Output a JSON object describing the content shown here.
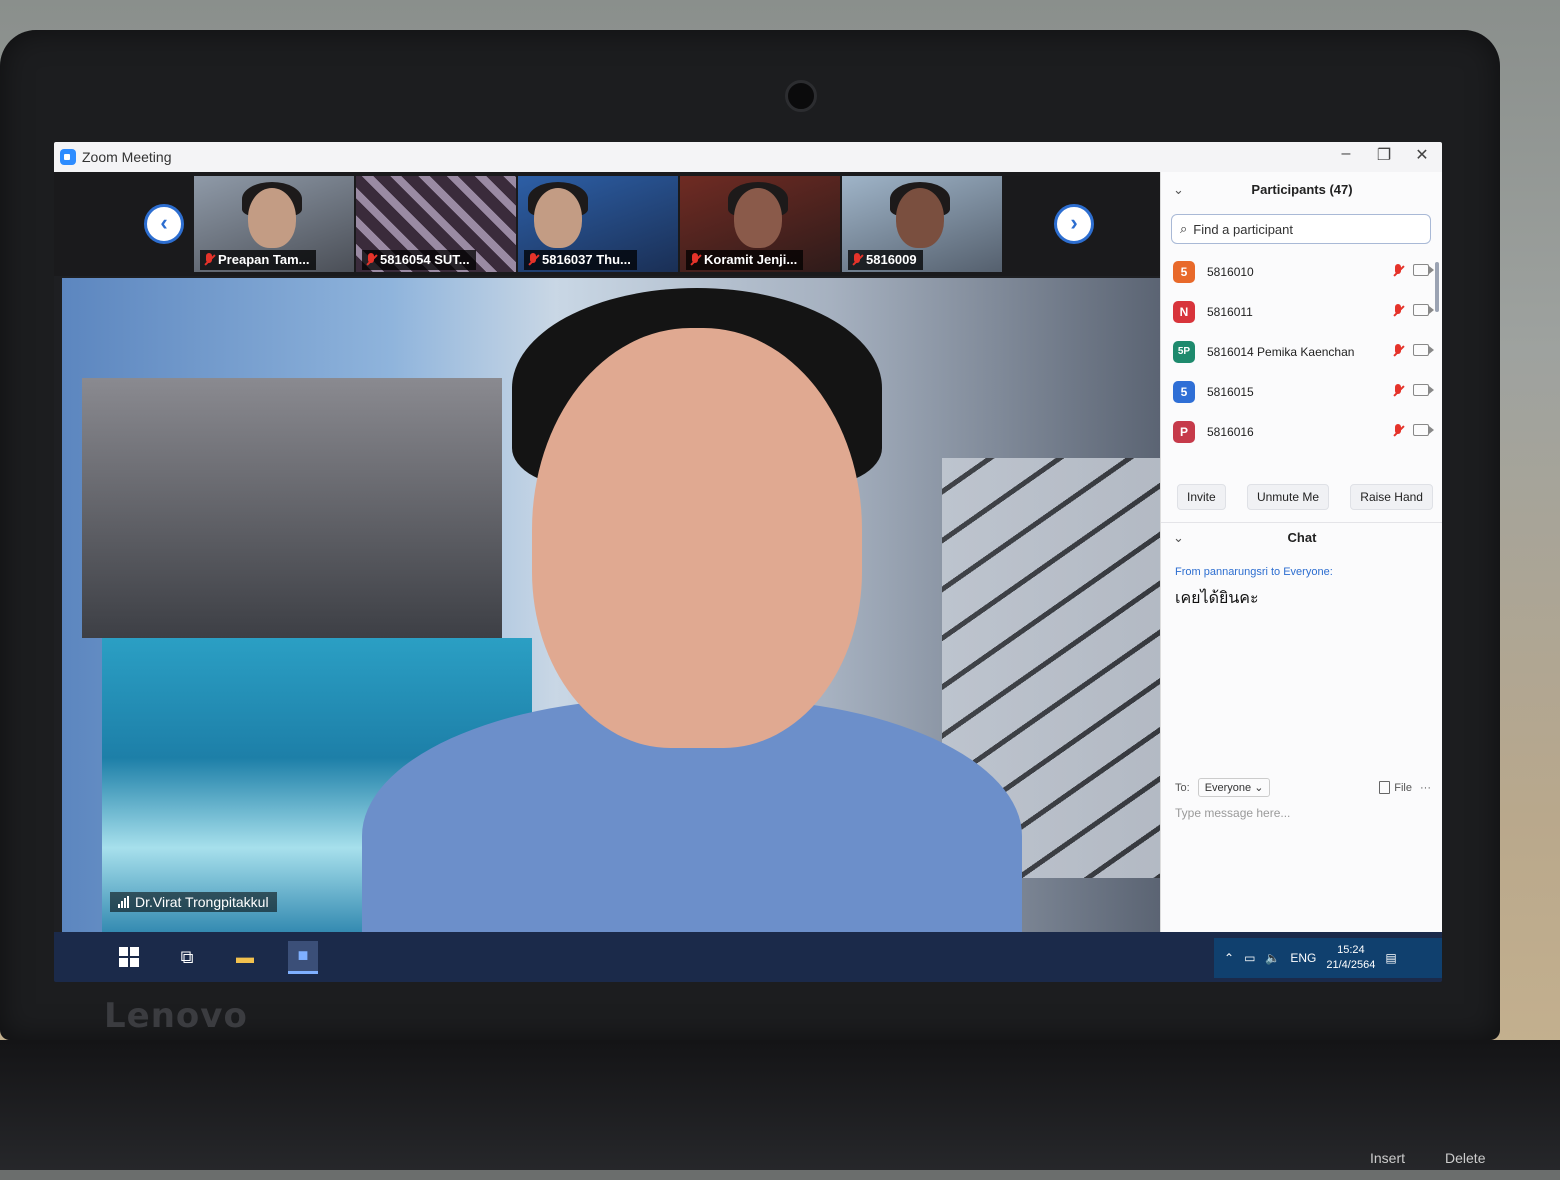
{
  "window": {
    "title": "Zoom Meeting",
    "controls": [
      "–",
      "❐",
      "✕"
    ]
  },
  "thumbnails": [
    {
      "name": "Preapan Tam..."
    },
    {
      "name": "5816054 SUT..."
    },
    {
      "name": "5816037 Thu..."
    },
    {
      "name": "Koramit Jenji..."
    },
    {
      "name": "5816009"
    }
  ],
  "nav": {
    "prev": "‹",
    "next": "›"
  },
  "speaker": {
    "name": "Dr.Virat Trongpitakkul"
  },
  "participants": {
    "header": "Participants (47)",
    "search_placeholder": "Find a participant",
    "items": [
      {
        "initial": "5",
        "name": "5816010",
        "color": "#e8692a"
      },
      {
        "initial": "N",
        "name": "5816011",
        "color": "#d8343b"
      },
      {
        "initial": "5P",
        "name": "5816014 Pemika Kaenchan",
        "color": "#1e8a6d"
      },
      {
        "initial": "5",
        "name": "5816015",
        "color": "#2f6fd6"
      },
      {
        "initial": "P",
        "name": "5816016",
        "color": "#c63a4a"
      }
    ],
    "buttons": {
      "invite": "Invite",
      "unmute": "Unmute Me",
      "raise_hand": "Raise Hand"
    }
  },
  "chat": {
    "header": "Chat",
    "from_line": "From pannarungsri to Everyone:",
    "message": "เคยได้ยินคะ",
    "to_label": "To:",
    "to_value": "Everyone ⌄",
    "file_label": "File",
    "more": "···",
    "input_placeholder": "Type message here..."
  },
  "taskbar": {
    "language": "ENG",
    "time": "15:24",
    "date": "21/4/2564"
  },
  "laptop": {
    "brand": "Lenovo"
  },
  "keyboard": {
    "keys": [
      "Insert",
      "Delete"
    ]
  }
}
